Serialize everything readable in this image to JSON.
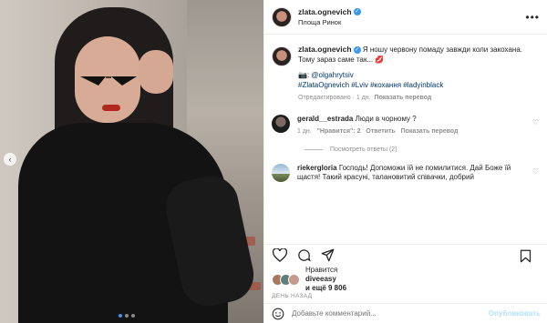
{
  "post": {
    "username": "zlata.ognevich",
    "location": "Площа Ринок",
    "more_icon": "more-icon"
  },
  "caption": {
    "username": "zlata.ognevich",
    "text_line1": "Я ношу червону помаду завжди коли закохана.",
    "text_line2": "Тому зараз саме так...",
    "emoji": "💋",
    "photo_credit_prefix": "📷:",
    "photo_credit": "@olgahrytsiv",
    "hashtags": "#ZlataOgnevich #Lviv #кохання #ladyinblack",
    "edited": "Отредактировано",
    "age": "1 дн.",
    "translate": "Показать перевод"
  },
  "comments": [
    {
      "username": "gerald__estrada",
      "text": "Люди в чорному ?",
      "age": "1 дн.",
      "likes": "\"Нравится\": 2",
      "reply": "Ответить",
      "translate": "Показать перевод",
      "view_replies": "Посмотреть ответы (2)"
    },
    {
      "username": "riekergloria",
      "text": "Господь! Допоможи їй не помилитися. Дай Боже їй щастя! Такий красуні, талановитий співачки, добрий"
    }
  ],
  "likes": {
    "liked_label": "Нравится",
    "liker": "diveeasy",
    "and_more": "и ещё 9 806"
  },
  "date": "ДЕНЬ НАЗАД",
  "add_comment": {
    "placeholder": "Добавьте комментарий...",
    "post_label": "Опубликовать"
  },
  "colors": {
    "accent": "#3897f0",
    "link": "#00376b",
    "muted": "#8e8e8e"
  }
}
